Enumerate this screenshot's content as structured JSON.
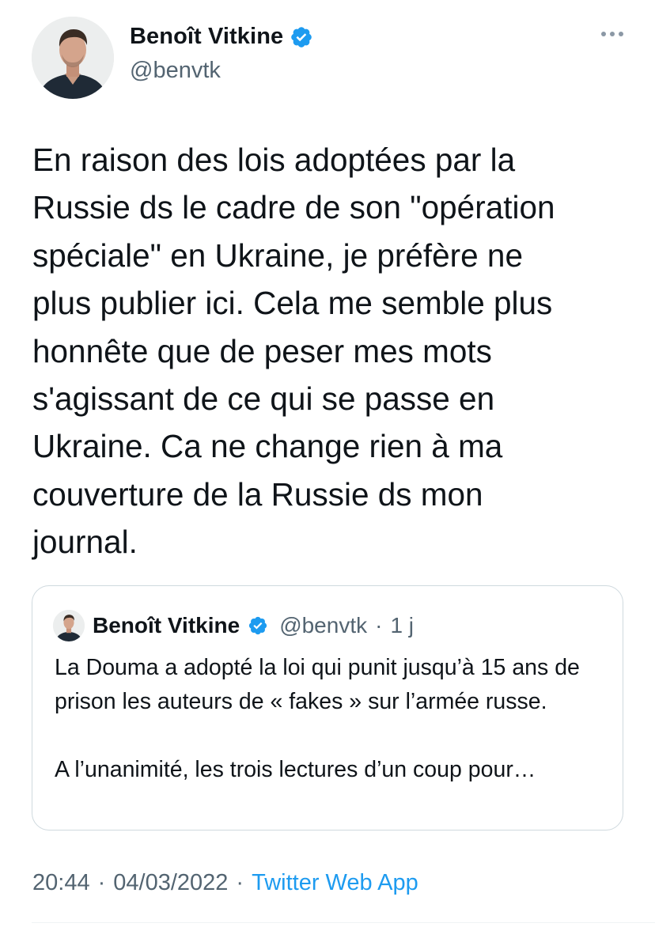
{
  "author": {
    "name": "Benoît Vitkine",
    "handle": "@benvtk",
    "verified": true
  },
  "tweet": {
    "text": "En raison des lois adoptées par la\nRussie ds le cadre de son \"opération\nspéciale\" en Ukraine, je préfère ne\nplus publier ici. Cela me semble plus\nhonnête que de peser mes mots\ns'agissant de ce qui se passe en\nUkraine. Ca ne change rien à ma\ncouverture de la Russie ds mon\njournal.",
    "time": "20:44",
    "separator": "·",
    "date": "04/03/2022",
    "source": "Twitter Web App"
  },
  "quote": {
    "name": "Benoît Vitkine",
    "handle": "@benvtk",
    "separator": "·",
    "age": "1 j",
    "paragraph1": "La Douma a adopté la loi qui punit jusqu’à 15 ans de prison les auteurs de « fakes » sur l’armée russe.",
    "paragraph2": "A l’unanimité, les trois lectures d’un coup pour…"
  },
  "icons": {
    "verified": "verified-badge-icon",
    "more": "more-dots-icon"
  },
  "colors": {
    "accent": "#1d9bf0",
    "text": "#0f1419",
    "muted": "#536471",
    "border": "#cfd9de"
  }
}
